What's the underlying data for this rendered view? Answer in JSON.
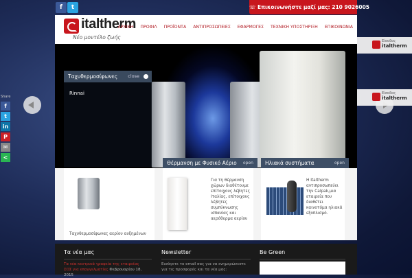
{
  "social": {
    "facebook": "f",
    "twitter": "t"
  },
  "contact": {
    "text": "☏ Επικοινωνήστε μαζί μας: 210 9026005"
  },
  "brand": {
    "name": "italtherm",
    "slogan": "Νέο μοντέλο ζωής"
  },
  "nav": [
    "ΑΡΧΙΚΗ",
    "ΠΡΟΦΙΛ",
    "ΠΡΟΪΟΝΤΑ",
    "ΑΝΤΙΠΡΟΣΩΠΕΙΕΣ",
    "ΕΦΑΡΜΟΓΕΣ",
    "ΤΕΧΝΙΚΗ ΥΠΟΣΤΗΡΙΞΗ",
    "ΕΠΙΚΟΙΝΩΝΙΑ"
  ],
  "panel": {
    "title": "Ταχυθερμοσίφωνες",
    "close": "close",
    "item": "Rinnai"
  },
  "tabs": [
    {
      "title": "Θέρμανση με Φυσικό Αέριο",
      "open": "open"
    },
    {
      "title": "Ηλιακά συστήματα",
      "open": "open"
    }
  ],
  "columns": {
    "left": {
      "text": "Ταχυθερμοσίφωνας αερίου αυξημένων"
    },
    "middle": {
      "text": "Για τη θέρμανση χώρων διαθέτουμε επίτοιχους λέβητες Ιταλίας, επίτοιχους λέβητες συμπύκνωσης ισπανίας και αερόθερμα αερίου"
    },
    "right": {
      "text": "Η Italtherm αντιπροσωπεύει την Calpak,μια εταιρεία που διαθέτει καινοτόμα ηλιακά εξοπλισμό."
    }
  },
  "footer": {
    "news_title": "Τα νέα μας",
    "news_item": "Τα νέα κεντρικά γραφεία της εταιρείας",
    "news_date": "Φεβρουαρίου 18, 2015",
    "news_line2": "ΣΟΣ για επαγγελματίες",
    "newsletter_title": "Newsletter",
    "newsletter_text": "Εισάγετε το email σας για να ενημερώνεστε για τις προσφορές και τα νέα μας:",
    "green_title": "Be Green"
  },
  "side_logos": [
    {
      "name": "italtherm",
      "sub": "Είσοδος"
    },
    {
      "name": "italtherm",
      "sub": "Είσοδος"
    }
  ],
  "share": {
    "label": "Share"
  }
}
